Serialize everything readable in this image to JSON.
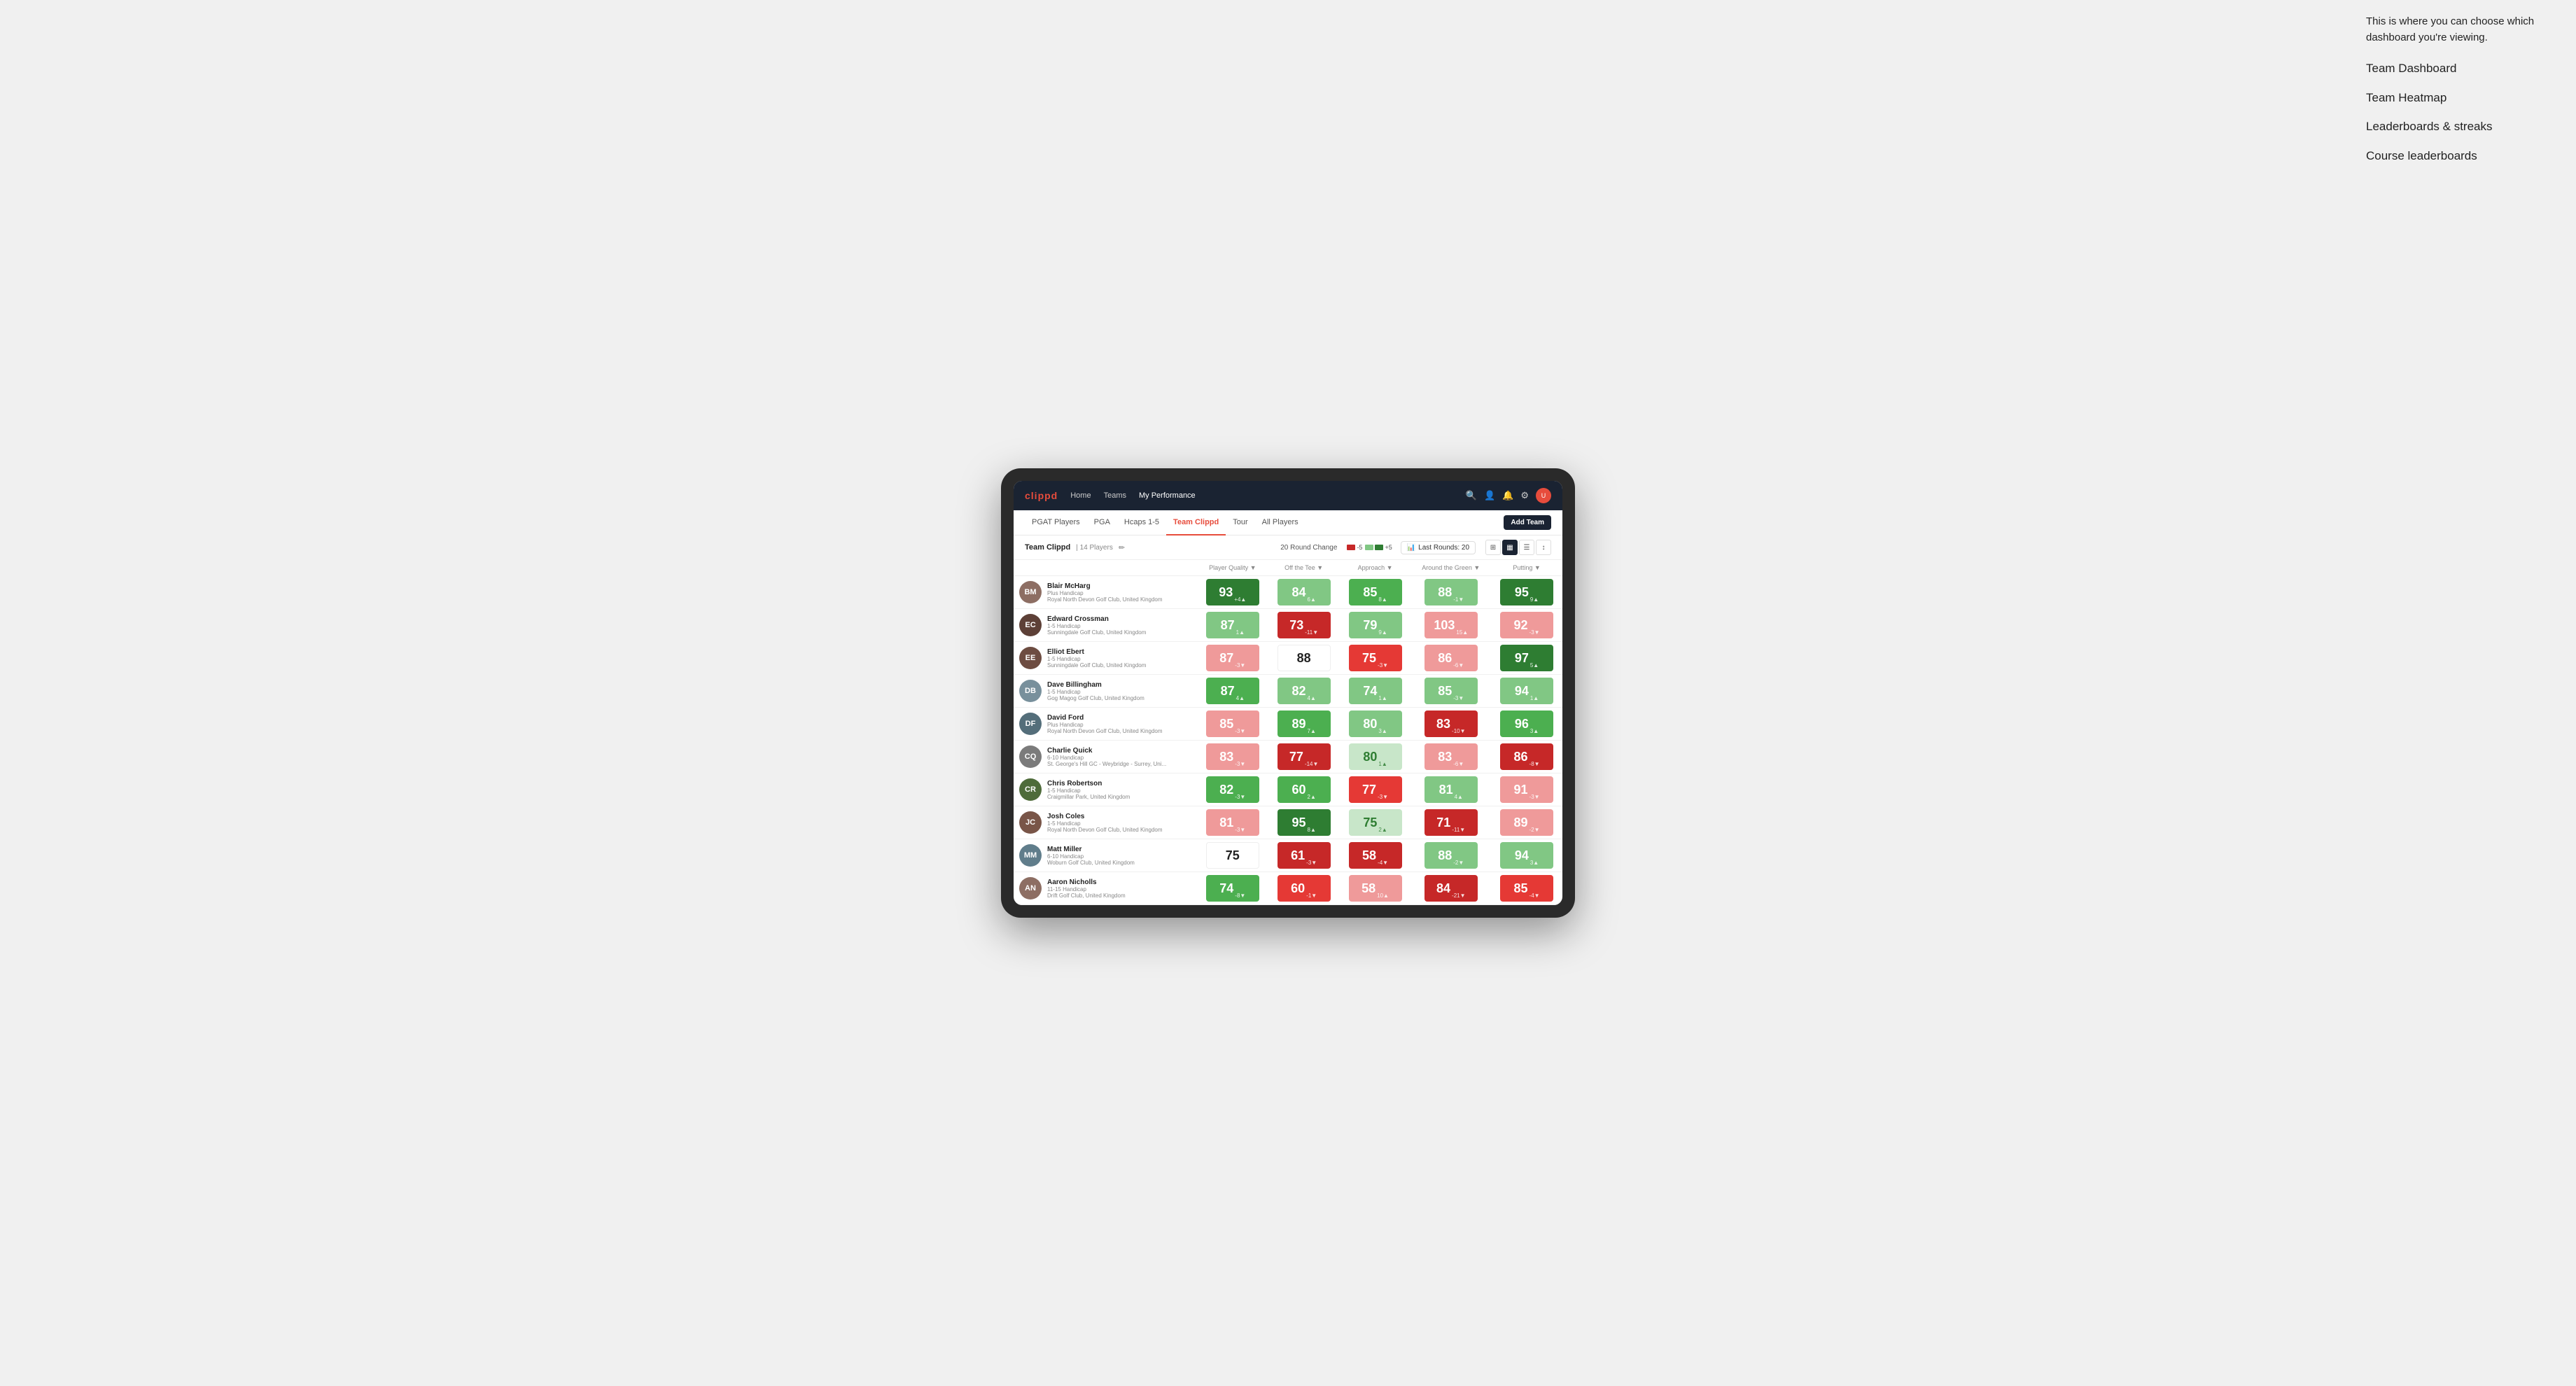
{
  "annotation": {
    "description": "This is where you can choose which dashboard you're viewing.",
    "menu_items": [
      "Team Dashboard",
      "Team Heatmap",
      "Leaderboards & streaks",
      "Course leaderboards"
    ]
  },
  "nav": {
    "logo": "clippd",
    "links": [
      "Home",
      "Teams",
      "My Performance"
    ],
    "active_link": "My Performance"
  },
  "sub_nav": {
    "links": [
      "PGAT Players",
      "PGA",
      "Hcaps 1-5",
      "Team Clippd",
      "Tour",
      "All Players"
    ],
    "active": "Team Clippd",
    "add_team": "Add Team"
  },
  "team_header": {
    "name": "Team Clippd",
    "separator": "|",
    "count": "14 Players",
    "round_change_label": "20 Round Change",
    "minus_label": "-5",
    "plus_label": "+5",
    "last_rounds_label": "Last Rounds:",
    "last_rounds_value": "20"
  },
  "table": {
    "columns": [
      "Player Quality ▼",
      "Off the Tee ▼",
      "Approach ▼",
      "Around the Green ▼",
      "Putting ▼"
    ],
    "rows": [
      {
        "name": "Blair McHarg",
        "handicap": "Plus Handicap",
        "club": "Royal North Devon Golf Club, United Kingdom",
        "initials": "BM",
        "avatar_color": "#8d6e63",
        "scores": [
          {
            "value": 93,
            "change": "+4",
            "dir": "up",
            "color": "green-dark"
          },
          {
            "value": 84,
            "change": "6",
            "dir": "up",
            "color": "green-light"
          },
          {
            "value": 85,
            "change": "8",
            "dir": "up",
            "color": "green-mid"
          },
          {
            "value": 88,
            "change": "-1",
            "dir": "down",
            "color": "green-light"
          },
          {
            "value": 95,
            "change": "9",
            "dir": "up",
            "color": "green-dark"
          }
        ]
      },
      {
        "name": "Edward Crossman",
        "handicap": "1-5 Handicap",
        "club": "Sunningdale Golf Club, United Kingdom",
        "initials": "EC",
        "avatar_color": "#5d4037",
        "scores": [
          {
            "value": 87,
            "change": "1",
            "dir": "up",
            "color": "green-light"
          },
          {
            "value": 73,
            "change": "-11",
            "dir": "down",
            "color": "red-dark"
          },
          {
            "value": 79,
            "change": "9",
            "dir": "up",
            "color": "green-light"
          },
          {
            "value": 103,
            "change": "15",
            "dir": "up",
            "color": "red-light"
          },
          {
            "value": 92,
            "change": "-3",
            "dir": "down",
            "color": "red-light"
          }
        ]
      },
      {
        "name": "Elliot Ebert",
        "handicap": "1-5 Handicap",
        "club": "Sunningdale Golf Club, United Kingdom",
        "initials": "EE",
        "avatar_color": "#6d4c41",
        "scores": [
          {
            "value": 87,
            "change": "-3",
            "dir": "down",
            "color": "red-light"
          },
          {
            "value": 88,
            "change": "",
            "dir": "",
            "color": "white-cell"
          },
          {
            "value": 75,
            "change": "-3",
            "dir": "down",
            "color": "red-mid"
          },
          {
            "value": 86,
            "change": "-6",
            "dir": "down",
            "color": "red-light"
          },
          {
            "value": 97,
            "change": "5",
            "dir": "up",
            "color": "green-dark"
          }
        ]
      },
      {
        "name": "Dave Billingham",
        "handicap": "1-5 Handicap",
        "club": "Gog Magog Golf Club, United Kingdom",
        "initials": "DB",
        "avatar_color": "#78909c",
        "scores": [
          {
            "value": 87,
            "change": "4",
            "dir": "up",
            "color": "green-mid"
          },
          {
            "value": 82,
            "change": "4",
            "dir": "up",
            "color": "green-light"
          },
          {
            "value": 74,
            "change": "1",
            "dir": "up",
            "color": "green-light"
          },
          {
            "value": 85,
            "change": "-3",
            "dir": "down",
            "color": "green-light"
          },
          {
            "value": 94,
            "change": "1",
            "dir": "up",
            "color": "green-light"
          }
        ]
      },
      {
        "name": "David Ford",
        "handicap": "Plus Handicap",
        "club": "Royal North Devon Golf Club, United Kingdom",
        "initials": "DF",
        "avatar_color": "#546e7a",
        "scores": [
          {
            "value": 85,
            "change": "-3",
            "dir": "down",
            "color": "red-light"
          },
          {
            "value": 89,
            "change": "7",
            "dir": "up",
            "color": "green-mid"
          },
          {
            "value": 80,
            "change": "3",
            "dir": "up",
            "color": "green-light"
          },
          {
            "value": 83,
            "change": "-10",
            "dir": "down",
            "color": "red-dark"
          },
          {
            "value": 96,
            "change": "3",
            "dir": "up",
            "color": "green-mid"
          }
        ]
      },
      {
        "name": "Charlie Quick",
        "handicap": "6-10 Handicap",
        "club": "St. George's Hill GC - Weybridge - Surrey, Uni...",
        "initials": "CQ",
        "avatar_color": "#7b7b7b",
        "scores": [
          {
            "value": 83,
            "change": "-3",
            "dir": "down",
            "color": "red-light"
          },
          {
            "value": 77,
            "change": "-14",
            "dir": "down",
            "color": "red-dark"
          },
          {
            "value": 80,
            "change": "1",
            "dir": "up",
            "color": "green-pale"
          },
          {
            "value": 83,
            "change": "-6",
            "dir": "down",
            "color": "red-light"
          },
          {
            "value": 86,
            "change": "-8",
            "dir": "down",
            "color": "red-dark"
          }
        ]
      },
      {
        "name": "Chris Robertson",
        "handicap": "1-5 Handicap",
        "club": "Craigmillar Park, United Kingdom",
        "initials": "CR",
        "avatar_color": "#4e6b3a",
        "scores": [
          {
            "value": 82,
            "change": "-3",
            "dir": "down",
            "color": "green-mid"
          },
          {
            "value": 60,
            "change": "2",
            "dir": "up",
            "color": "green-mid"
          },
          {
            "value": 77,
            "change": "-3",
            "dir": "down",
            "color": "red-mid"
          },
          {
            "value": 81,
            "change": "4",
            "dir": "up",
            "color": "green-light"
          },
          {
            "value": 91,
            "change": "-3",
            "dir": "down",
            "color": "red-light"
          }
        ]
      },
      {
        "name": "Josh Coles",
        "handicap": "1-5 Handicap",
        "club": "Royal North Devon Golf Club, United Kingdom",
        "initials": "JC",
        "avatar_color": "#795548",
        "scores": [
          {
            "value": 81,
            "change": "-3",
            "dir": "down",
            "color": "red-light"
          },
          {
            "value": 95,
            "change": "8",
            "dir": "up",
            "color": "green-dark"
          },
          {
            "value": 75,
            "change": "2",
            "dir": "up",
            "color": "green-pale"
          },
          {
            "value": 71,
            "change": "-11",
            "dir": "down",
            "color": "red-dark"
          },
          {
            "value": 89,
            "change": "-2",
            "dir": "down",
            "color": "red-light"
          }
        ]
      },
      {
        "name": "Matt Miller",
        "handicap": "6-10 Handicap",
        "club": "Woburn Golf Club, United Kingdom",
        "initials": "MM",
        "avatar_color": "#607d8b",
        "scores": [
          {
            "value": 75,
            "change": "",
            "dir": "",
            "color": "white-cell"
          },
          {
            "value": 61,
            "change": "-3",
            "dir": "down",
            "color": "red-dark"
          },
          {
            "value": 58,
            "change": "-4",
            "dir": "down",
            "color": "red-dark"
          },
          {
            "value": 88,
            "change": "-2",
            "dir": "down",
            "color": "green-light"
          },
          {
            "value": 94,
            "change": "3",
            "dir": "up",
            "color": "green-light"
          }
        ]
      },
      {
        "name": "Aaron Nicholls",
        "handicap": "11-15 Handicap",
        "club": "Drift Golf Club, United Kingdom",
        "initials": "AN",
        "avatar_color": "#8d6e63",
        "scores": [
          {
            "value": 74,
            "change": "-8",
            "dir": "down",
            "color": "green-mid"
          },
          {
            "value": 60,
            "change": "-1",
            "dir": "down",
            "color": "red-mid"
          },
          {
            "value": 58,
            "change": "10",
            "dir": "up",
            "color": "red-light"
          },
          {
            "value": 84,
            "change": "-21",
            "dir": "down",
            "color": "red-dark"
          },
          {
            "value": 85,
            "change": "-4",
            "dir": "down",
            "color": "red-mid"
          }
        ]
      }
    ]
  }
}
